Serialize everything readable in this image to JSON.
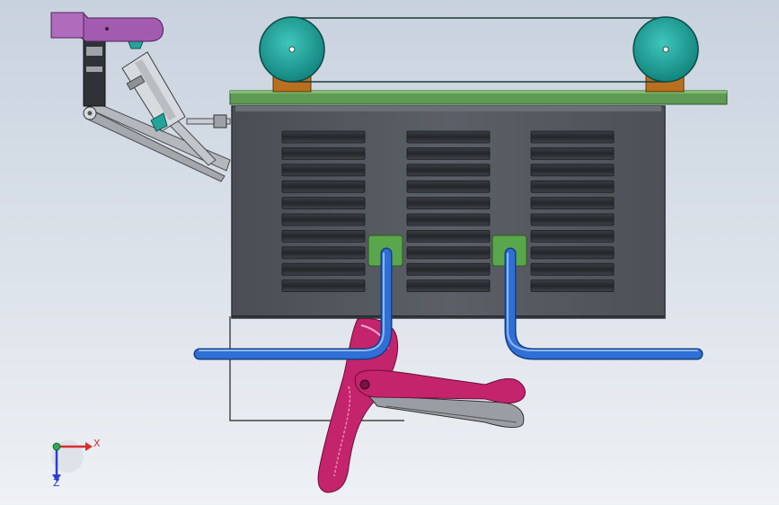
{
  "viewport": {
    "background_top": "#c8d2de",
    "background_bottom": "#eef1f5"
  },
  "colors": {
    "housing": "#55595f",
    "housing_edge": "#2e3135",
    "vent_slot": "#2b2e33",
    "base_plate": "#5e9a52",
    "pulley": "#1fa59d",
    "pulley_mount": "#b8701f",
    "pipe": "#2f6fd6",
    "pipe_fitting": "#5aa64c",
    "gripper_tool": "#c4246c",
    "arm_purple": "#a35bb0",
    "arm_link": "#b4b7bc",
    "cylinder": "#c9ccd1"
  },
  "triad": {
    "x_label": "X",
    "z_label": "Z",
    "x_color": "#d63030",
    "y_color": "#2fa84f",
    "z_color": "#2a3fd1"
  },
  "icons": {
    "coordinate_triad": "xyz-axis-triad-icon"
  }
}
